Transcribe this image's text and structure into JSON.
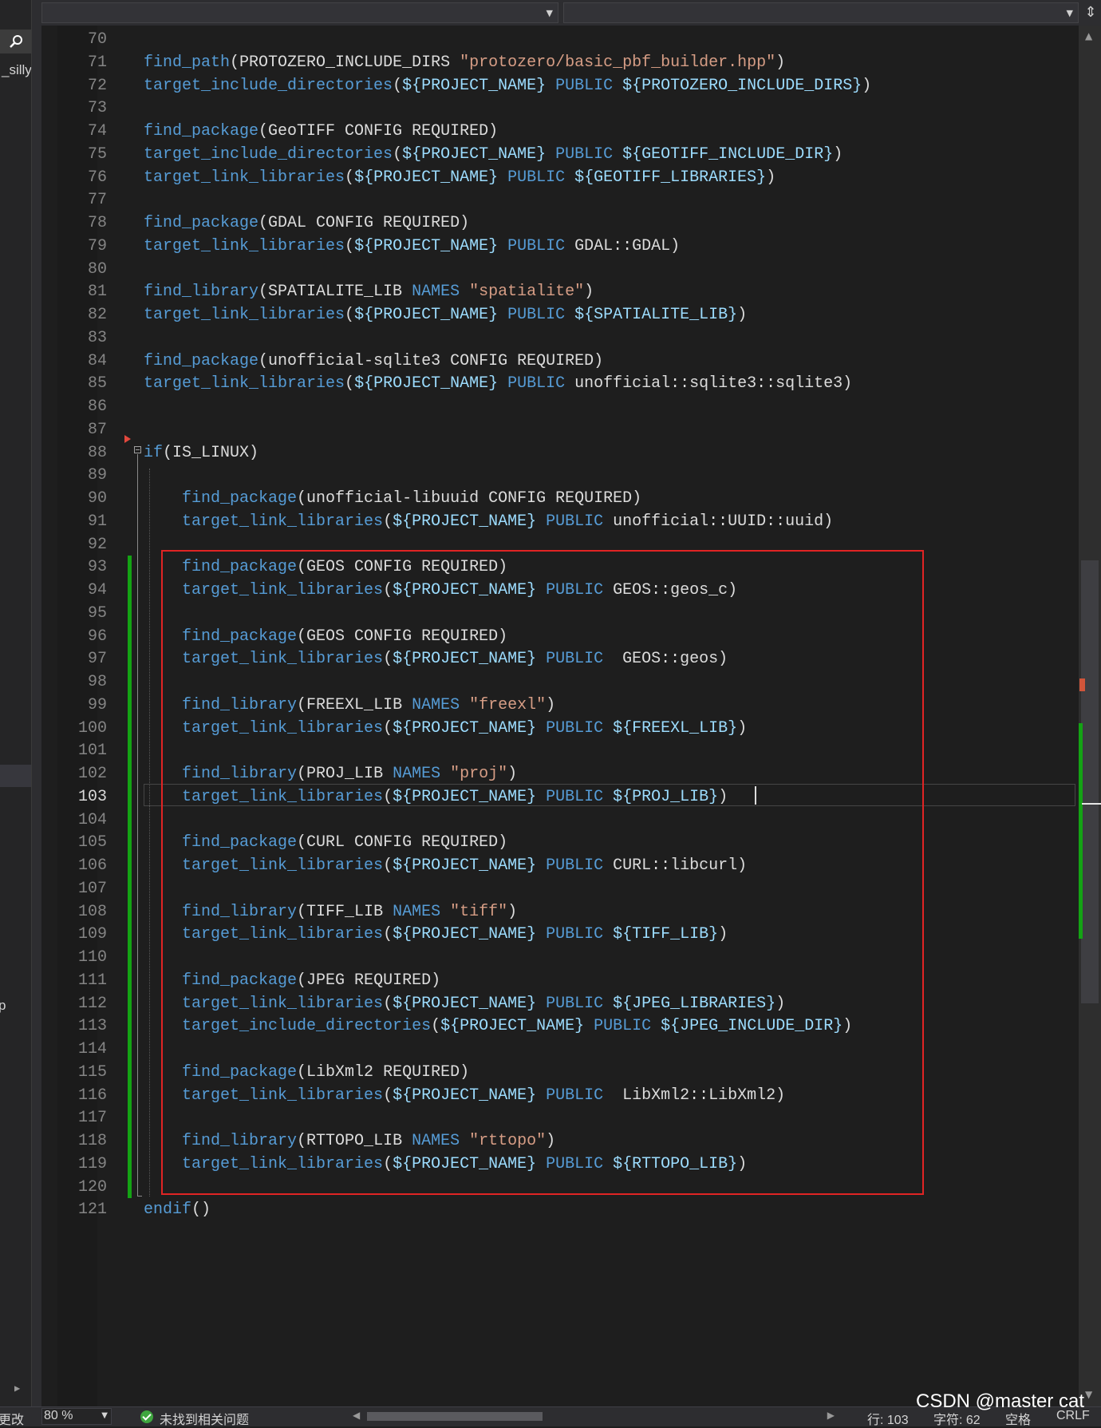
{
  "left_panel": {
    "peek_top": "_silly",
    "peek_mid": "p"
  },
  "editor": {
    "lines": [
      {
        "n": "70",
        "tokens": []
      },
      {
        "n": "71",
        "tokens": [
          {
            "t": "find_path",
            "c": "fn"
          },
          {
            "t": "(PROTOZERO_INCLUDE_DIRS ",
            "c": "pl"
          },
          {
            "t": "\"protozero/basic_pbf_builder.hpp\"",
            "c": "str"
          },
          {
            "t": ")",
            "c": "pl"
          }
        ]
      },
      {
        "n": "72",
        "tokens": [
          {
            "t": "target_include_directories",
            "c": "fn"
          },
          {
            "t": "(",
            "c": "pl"
          },
          {
            "t": "${PROJECT_NAME}",
            "c": "var"
          },
          {
            "t": " ",
            "c": "pl"
          },
          {
            "t": "PUBLIC",
            "c": "kw"
          },
          {
            "t": " ",
            "c": "pl"
          },
          {
            "t": "${PROTOZERO_INCLUDE_DIRS}",
            "c": "var"
          },
          {
            "t": ")",
            "c": "pl"
          }
        ]
      },
      {
        "n": "73",
        "tokens": []
      },
      {
        "n": "74",
        "tokens": [
          {
            "t": "find_package",
            "c": "fn"
          },
          {
            "t": "(GeoTIFF CONFIG REQUIRED)",
            "c": "pl"
          }
        ]
      },
      {
        "n": "75",
        "tokens": [
          {
            "t": "target_include_directories",
            "c": "fn"
          },
          {
            "t": "(",
            "c": "pl"
          },
          {
            "t": "${PROJECT_NAME}",
            "c": "var"
          },
          {
            "t": " ",
            "c": "pl"
          },
          {
            "t": "PUBLIC",
            "c": "kw"
          },
          {
            "t": " ",
            "c": "pl"
          },
          {
            "t": "${GEOTIFF_INCLUDE_DIR}",
            "c": "var"
          },
          {
            "t": ")",
            "c": "pl"
          }
        ]
      },
      {
        "n": "76",
        "tokens": [
          {
            "t": "target_link_libraries",
            "c": "fn"
          },
          {
            "t": "(",
            "c": "pl"
          },
          {
            "t": "${PROJECT_NAME}",
            "c": "var"
          },
          {
            "t": " ",
            "c": "pl"
          },
          {
            "t": "PUBLIC",
            "c": "kw"
          },
          {
            "t": " ",
            "c": "pl"
          },
          {
            "t": "${GEOTIFF_LIBRARIES}",
            "c": "var"
          },
          {
            "t": ")",
            "c": "pl"
          }
        ]
      },
      {
        "n": "77",
        "tokens": []
      },
      {
        "n": "78",
        "tokens": [
          {
            "t": "find_package",
            "c": "fn"
          },
          {
            "t": "(GDAL CONFIG REQUIRED)",
            "c": "pl"
          }
        ]
      },
      {
        "n": "79",
        "tokens": [
          {
            "t": "target_link_libraries",
            "c": "fn"
          },
          {
            "t": "(",
            "c": "pl"
          },
          {
            "t": "${PROJECT_NAME}",
            "c": "var"
          },
          {
            "t": " ",
            "c": "pl"
          },
          {
            "t": "PUBLIC",
            "c": "kw"
          },
          {
            "t": " GDAL::GDAL)",
            "c": "pl"
          }
        ]
      },
      {
        "n": "80",
        "tokens": []
      },
      {
        "n": "81",
        "tokens": [
          {
            "t": "find_library",
            "c": "fn"
          },
          {
            "t": "(SPATIALITE_LIB ",
            "c": "pl"
          },
          {
            "t": "NAMES",
            "c": "kw"
          },
          {
            "t": " ",
            "c": "pl"
          },
          {
            "t": "\"spatialite\"",
            "c": "str"
          },
          {
            "t": ")",
            "c": "pl"
          }
        ]
      },
      {
        "n": "82",
        "tokens": [
          {
            "t": "target_link_libraries",
            "c": "fn"
          },
          {
            "t": "(",
            "c": "pl"
          },
          {
            "t": "${PROJECT_NAME}",
            "c": "var"
          },
          {
            "t": " ",
            "c": "pl"
          },
          {
            "t": "PUBLIC",
            "c": "kw"
          },
          {
            "t": " ",
            "c": "pl"
          },
          {
            "t": "${SPATIALITE_LIB}",
            "c": "var"
          },
          {
            "t": ")",
            "c": "pl"
          }
        ]
      },
      {
        "n": "83",
        "tokens": []
      },
      {
        "n": "84",
        "tokens": [
          {
            "t": "find_package",
            "c": "fn"
          },
          {
            "t": "(unofficial-sqlite3 CONFIG REQUIRED)",
            "c": "pl"
          }
        ]
      },
      {
        "n": "85",
        "tokens": [
          {
            "t": "target_link_libraries",
            "c": "fn"
          },
          {
            "t": "(",
            "c": "pl"
          },
          {
            "t": "${PROJECT_NAME}",
            "c": "var"
          },
          {
            "t": " ",
            "c": "pl"
          },
          {
            "t": "PUBLIC",
            "c": "kw"
          },
          {
            "t": " unofficial::sqlite3::sqlite3)",
            "c": "pl"
          }
        ]
      },
      {
        "n": "86",
        "tokens": []
      },
      {
        "n": "87",
        "tokens": []
      },
      {
        "n": "88",
        "tokens": [
          {
            "t": "if",
            "c": "fn"
          },
          {
            "t": "(IS_LINUX)",
            "c": "pl"
          }
        ]
      },
      {
        "n": "89",
        "tokens": []
      },
      {
        "n": "90",
        "tokens": [
          {
            "t": "    ",
            "c": "pl"
          },
          {
            "t": "find_package",
            "c": "fn"
          },
          {
            "t": "(unofficial-libuuid CONFIG REQUIRED)",
            "c": "pl"
          }
        ]
      },
      {
        "n": "91",
        "tokens": [
          {
            "t": "    ",
            "c": "pl"
          },
          {
            "t": "target_link_libraries",
            "c": "fn"
          },
          {
            "t": "(",
            "c": "pl"
          },
          {
            "t": "${PROJECT_NAME}",
            "c": "var"
          },
          {
            "t": " ",
            "c": "pl"
          },
          {
            "t": "PUBLIC",
            "c": "kw"
          },
          {
            "t": " unofficial::UUID::uuid)",
            "c": "pl"
          }
        ]
      },
      {
        "n": "92",
        "tokens": []
      },
      {
        "n": "93",
        "tokens": [
          {
            "t": "    ",
            "c": "pl"
          },
          {
            "t": "find_package",
            "c": "fn"
          },
          {
            "t": "(GEOS CONFIG REQUIRED)",
            "c": "pl"
          }
        ]
      },
      {
        "n": "94",
        "tokens": [
          {
            "t": "    ",
            "c": "pl"
          },
          {
            "t": "target_link_libraries",
            "c": "fn"
          },
          {
            "t": "(",
            "c": "pl"
          },
          {
            "t": "${PROJECT_NAME}",
            "c": "var"
          },
          {
            "t": " ",
            "c": "pl"
          },
          {
            "t": "PUBLIC",
            "c": "kw"
          },
          {
            "t": " GEOS::geos_c)",
            "c": "pl"
          }
        ]
      },
      {
        "n": "95",
        "tokens": []
      },
      {
        "n": "96",
        "tokens": [
          {
            "t": "    ",
            "c": "pl"
          },
          {
            "t": "find_package",
            "c": "fn"
          },
          {
            "t": "(GEOS CONFIG REQUIRED)",
            "c": "pl"
          }
        ]
      },
      {
        "n": "97",
        "tokens": [
          {
            "t": "    ",
            "c": "pl"
          },
          {
            "t": "target_link_libraries",
            "c": "fn"
          },
          {
            "t": "(",
            "c": "pl"
          },
          {
            "t": "${PROJECT_NAME}",
            "c": "var"
          },
          {
            "t": " ",
            "c": "pl"
          },
          {
            "t": "PUBLIC",
            "c": "kw"
          },
          {
            "t": "  GEOS::geos)",
            "c": "pl"
          }
        ]
      },
      {
        "n": "98",
        "tokens": []
      },
      {
        "n": "99",
        "tokens": [
          {
            "t": "    ",
            "c": "pl"
          },
          {
            "t": "find_library",
            "c": "fn"
          },
          {
            "t": "(FREEXL_LIB ",
            "c": "pl"
          },
          {
            "t": "NAMES",
            "c": "kw"
          },
          {
            "t": " ",
            "c": "pl"
          },
          {
            "t": "\"freexl\"",
            "c": "str"
          },
          {
            "t": ")",
            "c": "pl"
          }
        ]
      },
      {
        "n": "100",
        "tokens": [
          {
            "t": "    ",
            "c": "pl"
          },
          {
            "t": "target_link_libraries",
            "c": "fn"
          },
          {
            "t": "(",
            "c": "pl"
          },
          {
            "t": "${PROJECT_NAME}",
            "c": "var"
          },
          {
            "t": " ",
            "c": "pl"
          },
          {
            "t": "PUBLIC",
            "c": "kw"
          },
          {
            "t": " ",
            "c": "pl"
          },
          {
            "t": "${FREEXL_LIB}",
            "c": "var"
          },
          {
            "t": ")",
            "c": "pl"
          }
        ]
      },
      {
        "n": "101",
        "tokens": []
      },
      {
        "n": "102",
        "tokens": [
          {
            "t": "    ",
            "c": "pl"
          },
          {
            "t": "find_library",
            "c": "fn"
          },
          {
            "t": "(PROJ_LIB ",
            "c": "pl"
          },
          {
            "t": "NAMES",
            "c": "kw"
          },
          {
            "t": " ",
            "c": "pl"
          },
          {
            "t": "\"proj\"",
            "c": "str"
          },
          {
            "t": ")",
            "c": "pl"
          }
        ]
      },
      {
        "n": "103",
        "tokens": [
          {
            "t": "    ",
            "c": "pl"
          },
          {
            "t": "target_link_libraries",
            "c": "fn"
          },
          {
            "t": "(",
            "c": "pl"
          },
          {
            "t": "${PROJECT_NAME}",
            "c": "var"
          },
          {
            "t": " ",
            "c": "pl"
          },
          {
            "t": "PUBLIC",
            "c": "kw"
          },
          {
            "t": " ",
            "c": "pl"
          },
          {
            "t": "${PROJ_LIB}",
            "c": "var"
          },
          {
            "t": ")",
            "c": "pl"
          }
        ]
      },
      {
        "n": "104",
        "tokens": []
      },
      {
        "n": "105",
        "tokens": [
          {
            "t": "    ",
            "c": "pl"
          },
          {
            "t": "find_package",
            "c": "fn"
          },
          {
            "t": "(CURL CONFIG REQUIRED)",
            "c": "pl"
          }
        ]
      },
      {
        "n": "106",
        "tokens": [
          {
            "t": "    ",
            "c": "pl"
          },
          {
            "t": "target_link_libraries",
            "c": "fn"
          },
          {
            "t": "(",
            "c": "pl"
          },
          {
            "t": "${PROJECT_NAME}",
            "c": "var"
          },
          {
            "t": " ",
            "c": "pl"
          },
          {
            "t": "PUBLIC",
            "c": "kw"
          },
          {
            "t": " CURL::libcurl)",
            "c": "pl"
          }
        ]
      },
      {
        "n": "107",
        "tokens": []
      },
      {
        "n": "108",
        "tokens": [
          {
            "t": "    ",
            "c": "pl"
          },
          {
            "t": "find_library",
            "c": "fn"
          },
          {
            "t": "(TIFF_LIB ",
            "c": "pl"
          },
          {
            "t": "NAMES",
            "c": "kw"
          },
          {
            "t": " ",
            "c": "pl"
          },
          {
            "t": "\"tiff\"",
            "c": "str"
          },
          {
            "t": ")",
            "c": "pl"
          }
        ]
      },
      {
        "n": "109",
        "tokens": [
          {
            "t": "    ",
            "c": "pl"
          },
          {
            "t": "target_link_libraries",
            "c": "fn"
          },
          {
            "t": "(",
            "c": "pl"
          },
          {
            "t": "${PROJECT_NAME}",
            "c": "var"
          },
          {
            "t": " ",
            "c": "pl"
          },
          {
            "t": "PUBLIC",
            "c": "kw"
          },
          {
            "t": " ",
            "c": "pl"
          },
          {
            "t": "${TIFF_LIB}",
            "c": "var"
          },
          {
            "t": ")",
            "c": "pl"
          }
        ]
      },
      {
        "n": "110",
        "tokens": []
      },
      {
        "n": "111",
        "tokens": [
          {
            "t": "    ",
            "c": "pl"
          },
          {
            "t": "find_package",
            "c": "fn"
          },
          {
            "t": "(JPEG REQUIRED)",
            "c": "pl"
          }
        ]
      },
      {
        "n": "112",
        "tokens": [
          {
            "t": "    ",
            "c": "pl"
          },
          {
            "t": "target_link_libraries",
            "c": "fn"
          },
          {
            "t": "(",
            "c": "pl"
          },
          {
            "t": "${PROJECT_NAME}",
            "c": "var"
          },
          {
            "t": " ",
            "c": "pl"
          },
          {
            "t": "PUBLIC",
            "c": "kw"
          },
          {
            "t": " ",
            "c": "pl"
          },
          {
            "t": "${JPEG_LIBRARIES}",
            "c": "var"
          },
          {
            "t": ")",
            "c": "pl"
          }
        ]
      },
      {
        "n": "113",
        "tokens": [
          {
            "t": "    ",
            "c": "pl"
          },
          {
            "t": "target_include_directories",
            "c": "fn"
          },
          {
            "t": "(",
            "c": "pl"
          },
          {
            "t": "${PROJECT_NAME}",
            "c": "var"
          },
          {
            "t": " ",
            "c": "pl"
          },
          {
            "t": "PUBLIC",
            "c": "kw"
          },
          {
            "t": " ",
            "c": "pl"
          },
          {
            "t": "${JPEG_INCLUDE_DIR}",
            "c": "var"
          },
          {
            "t": ")",
            "c": "pl"
          }
        ]
      },
      {
        "n": "114",
        "tokens": []
      },
      {
        "n": "115",
        "tokens": [
          {
            "t": "    ",
            "c": "pl"
          },
          {
            "t": "find_package",
            "c": "fn"
          },
          {
            "t": "(LibXml2 REQUIRED)",
            "c": "pl"
          }
        ]
      },
      {
        "n": "116",
        "tokens": [
          {
            "t": "    ",
            "c": "pl"
          },
          {
            "t": "target_link_libraries",
            "c": "fn"
          },
          {
            "t": "(",
            "c": "pl"
          },
          {
            "t": "${PROJECT_NAME}",
            "c": "var"
          },
          {
            "t": " ",
            "c": "pl"
          },
          {
            "t": "PUBLIC",
            "c": "kw"
          },
          {
            "t": "  LibXml2::LibXml2)",
            "c": "pl"
          }
        ]
      },
      {
        "n": "117",
        "tokens": []
      },
      {
        "n": "118",
        "tokens": [
          {
            "t": "    ",
            "c": "pl"
          },
          {
            "t": "find_library",
            "c": "fn"
          },
          {
            "t": "(RTTOPO_LIB ",
            "c": "pl"
          },
          {
            "t": "NAMES",
            "c": "kw"
          },
          {
            "t": " ",
            "c": "pl"
          },
          {
            "t": "\"rttopo\"",
            "c": "str"
          },
          {
            "t": ")",
            "c": "pl"
          }
        ]
      },
      {
        "n": "119",
        "tokens": [
          {
            "t": "    ",
            "c": "pl"
          },
          {
            "t": "target_link_libraries",
            "c": "fn"
          },
          {
            "t": "(",
            "c": "pl"
          },
          {
            "t": "${PROJECT_NAME}",
            "c": "var"
          },
          {
            "t": " ",
            "c": "pl"
          },
          {
            "t": "PUBLIC",
            "c": "kw"
          },
          {
            "t": " ",
            "c": "pl"
          },
          {
            "t": "${RTTOPO_LIB}",
            "c": "var"
          },
          {
            "t": ")",
            "c": "pl"
          }
        ]
      },
      {
        "n": "120",
        "tokens": []
      },
      {
        "n": "121",
        "tokens": [
          {
            "t": "endif",
            "c": "fn"
          },
          {
            "t": "()",
            "c": "pl"
          }
        ]
      }
    ],
    "current_line": "103",
    "colors": {
      "function": "#569cd6",
      "keyword": "#569cd6",
      "string": "#d69d85",
      "variable": "#9cdcfe",
      "plain": "#dcdcdc",
      "line_number": "#858585",
      "change_bar": "#14a314",
      "highlight_box": "#e02424"
    }
  },
  "status": {
    "zoom": "80 %",
    "issues": "未找到相关问题",
    "line": "行: 103",
    "char": "字符: 62",
    "indent": "空格",
    "eol": "CRLF",
    "left_fragment": "更改"
  },
  "watermark": "CSDN @master cat",
  "icons": {
    "search": "search-icon",
    "split": "split-editor-icon",
    "ok": "check-circle-icon"
  }
}
